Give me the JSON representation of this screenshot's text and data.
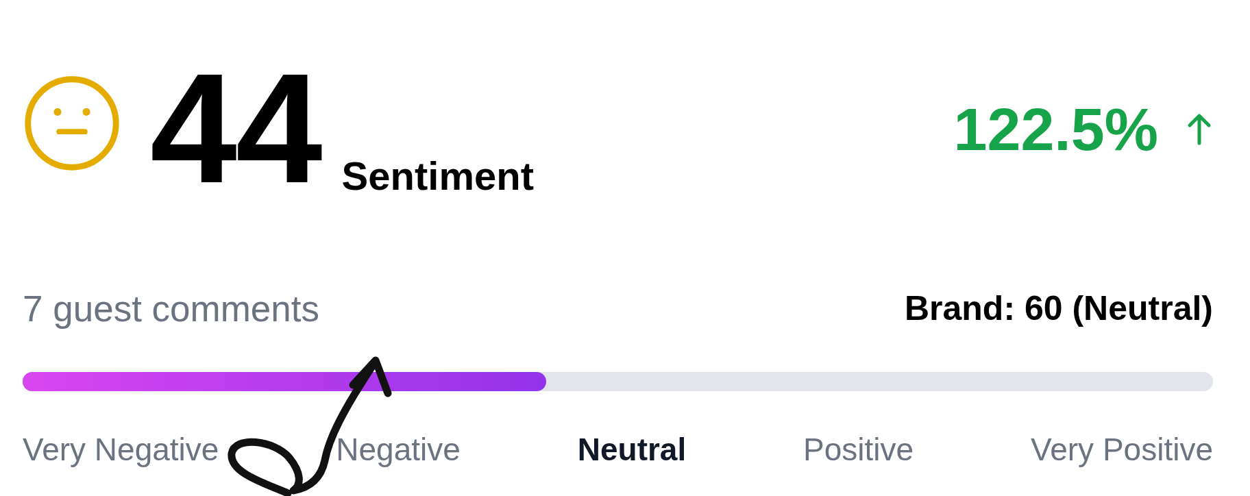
{
  "score": {
    "value": "44",
    "label": "Sentiment"
  },
  "change": {
    "value": "122.5%"
  },
  "comments": "7 guest comments",
  "brand": "Brand: 60 (Neutral)",
  "meter": {
    "level": 0.44
  },
  "scale": [
    {
      "label": "Very Negative",
      "selected": false
    },
    {
      "label": "Negative",
      "selected": false
    },
    {
      "label": "Neutral",
      "selected": true
    },
    {
      "label": "Positive",
      "selected": false
    },
    {
      "label": "Very Positive",
      "selected": false
    }
  ],
  "annotation": {
    "kind": "arrow"
  }
}
